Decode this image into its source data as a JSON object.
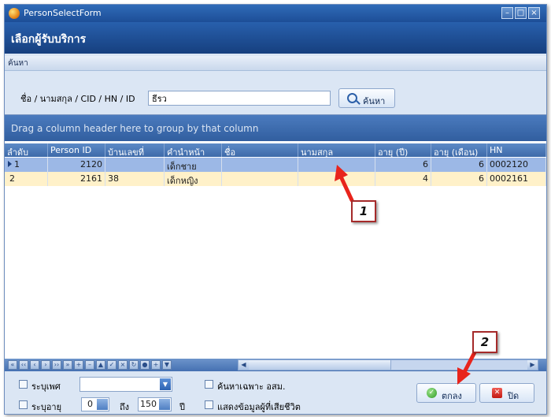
{
  "window": {
    "title": "PersonSelectForm"
  },
  "header": {
    "title": "เลือกผู้รับบริการ"
  },
  "section": {
    "label": "ค้นหา"
  },
  "search": {
    "label": "ชื่อ / นามสกุล / CID / HN / ID",
    "value": "ธีรว",
    "button_label": "ค้นหา"
  },
  "grid": {
    "group_hint": "Drag a column header here to group by that column",
    "columns": [
      "ลำดับ",
      "Person ID",
      "บ้านเลขที่",
      "คำนำหน้า",
      "ชื่อ",
      "นามสกุล",
      "อายุ (ปี)",
      "อายุ (เดือน)",
      "HN"
    ],
    "rows": [
      {
        "index": "1",
        "person_id": "2120",
        "house_no": "",
        "prefix": "เด็กชาย",
        "first_name": "",
        "last_name": "",
        "age_years": "6",
        "age_months": "6",
        "hn": "0002120"
      },
      {
        "index": "2",
        "person_id": "2161",
        "house_no": "38",
        "prefix": "เด็กหญิง",
        "first_name": "",
        "last_name": "",
        "age_years": "4",
        "age_months": "6",
        "hn": "0002161"
      }
    ]
  },
  "filters": {
    "sex_label": "ระบุเพศ",
    "age_label": "ระบุอายุ",
    "age_from": "0",
    "age_to_label": "ถึง",
    "age_to": "150",
    "age_unit": "ปี",
    "vhv_only_label": "ค้นหาเฉพาะ อสม.",
    "show_deceased_label": "แสดงข้อมูลผู้ที่เสียชีวิต"
  },
  "buttons": {
    "ok_label": "ตกลง",
    "close_label": "ปิด"
  },
  "callouts": [
    "1",
    "2"
  ],
  "colors": {
    "title_bar": "#1d4e97",
    "selected_row": "#9cb8e6",
    "alt_row": "#fff1c9",
    "callout_border": "#a52a2a",
    "arrow": "#e8241c"
  }
}
